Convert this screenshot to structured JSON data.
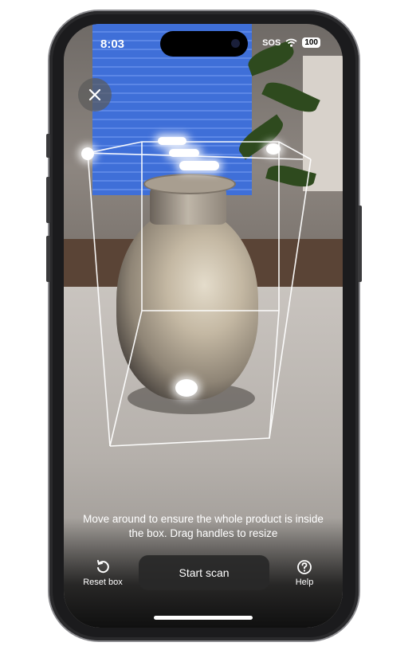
{
  "status_bar": {
    "time": "8:03",
    "sos": "SOS",
    "battery": "100"
  },
  "icons": {
    "close": "close-icon",
    "reset": "reset-icon",
    "help": "help-icon",
    "wifi": "wifi-icon"
  },
  "scanner": {
    "instruction": "Move around to ensure the whole product is inside the box. Drag handles to resize",
    "start_label": "Start scan",
    "reset_label": "Reset box",
    "help_label": "Help"
  }
}
